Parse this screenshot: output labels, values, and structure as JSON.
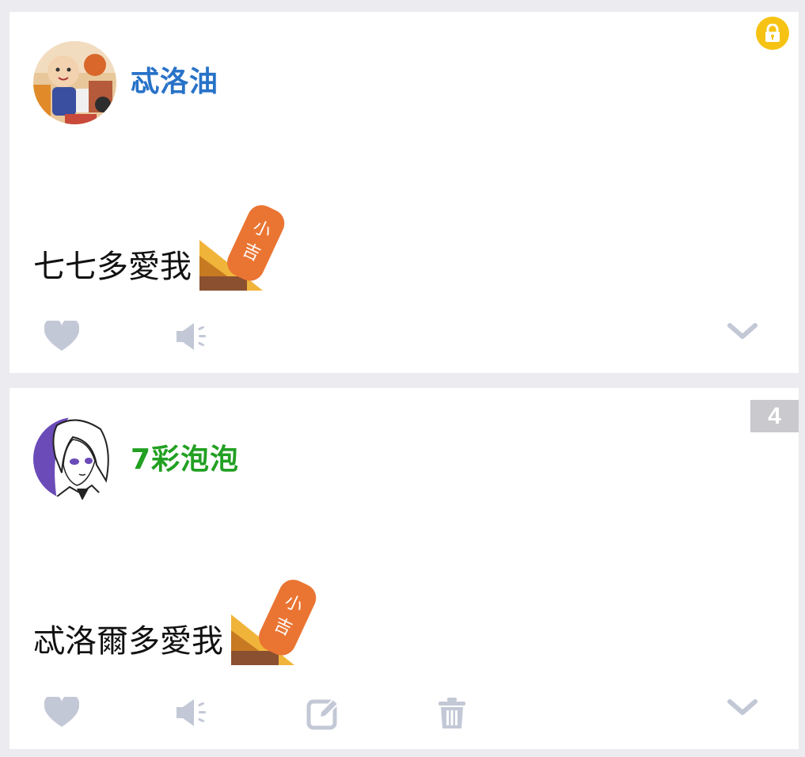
{
  "colors": {
    "background": "#ebebf0",
    "card": "#ffffff",
    "action_icon": "#c3c8d6",
    "lock_badge": "#f6c315",
    "floor_badge": "#c9c9ce"
  },
  "posts": [
    {
      "author": {
        "name": "忒洛油",
        "color": "#2872c8"
      },
      "avatar": "cartoon-avatar",
      "text": "七七多愛我",
      "sticker": {
        "icon": "sticker-icon",
        "text": "小吉"
      },
      "badge": {
        "type": "lock",
        "icon": "lock-icon"
      },
      "actions": [
        "like-icon",
        "speaker-icon",
        "expand-icon"
      ]
    },
    {
      "author": {
        "name": "7彩泡泡",
        "color": "#22a022"
      },
      "avatar": "anime-girl-avatar",
      "text": "忒洛爾多愛我",
      "sticker": {
        "icon": "sticker-icon",
        "text": "小吉"
      },
      "badge": {
        "type": "floor",
        "value": "4"
      },
      "actions": [
        "like-icon",
        "speaker-icon",
        "edit-icon",
        "delete-icon",
        "expand-icon"
      ]
    }
  ]
}
